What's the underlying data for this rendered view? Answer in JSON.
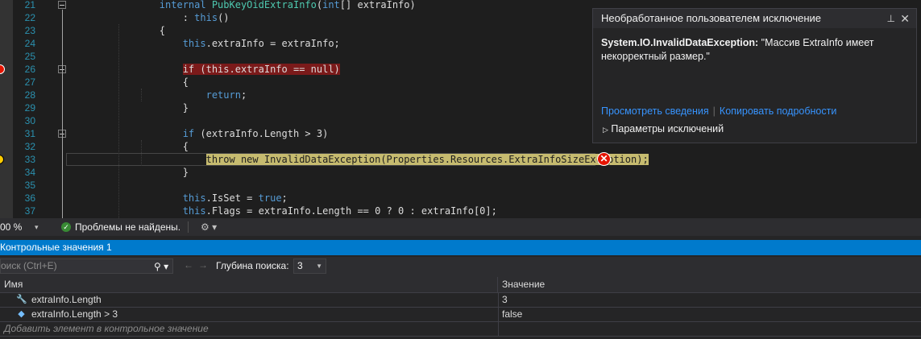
{
  "editor": {
    "lines": [
      {
        "num": "21",
        "segments": [
          {
            "t": "        "
          },
          {
            "t": "internal",
            "c": "kw"
          },
          {
            "t": " "
          },
          {
            "t": "PubKeyOidExtraInfo",
            "c": "ty"
          },
          {
            "t": "("
          },
          {
            "t": "int",
            "c": "kw"
          },
          {
            "t": "[] extraInfo)"
          }
        ]
      },
      {
        "num": "22",
        "segments": [
          {
            "t": "            : "
          },
          {
            "t": "this",
            "c": "kw"
          },
          {
            "t": "()"
          }
        ]
      },
      {
        "num": "23",
        "segments": [
          {
            "t": "        {"
          }
        ]
      },
      {
        "num": "24",
        "segments": [
          {
            "t": "            "
          },
          {
            "t": "this",
            "c": "kw"
          },
          {
            "t": ".extraInfo = extraInfo;"
          }
        ]
      },
      {
        "num": "25",
        "segments": [
          {
            "t": ""
          }
        ]
      },
      {
        "num": "26",
        "segments": [
          {
            "t": "            "
          },
          {
            "t": "if (this.extraInfo == null)",
            "c": "hl-red"
          }
        ]
      },
      {
        "num": "27",
        "segments": [
          {
            "t": "            {"
          }
        ]
      },
      {
        "num": "28",
        "segments": [
          {
            "t": "                "
          },
          {
            "t": "return",
            "c": "kw"
          },
          {
            "t": ";"
          }
        ]
      },
      {
        "num": "29",
        "segments": [
          {
            "t": "            }"
          }
        ]
      },
      {
        "num": "30",
        "segments": [
          {
            "t": ""
          }
        ]
      },
      {
        "num": "31",
        "segments": [
          {
            "t": "            "
          },
          {
            "t": "if",
            "c": "kw"
          },
          {
            "t": " (extraInfo.Length > 3)"
          }
        ]
      },
      {
        "num": "32",
        "segments": [
          {
            "t": "            {"
          }
        ]
      },
      {
        "num": "33",
        "segments": [
          {
            "t": "                "
          },
          {
            "t": "throw new InvalidDataException(Properties.Resources.ExtraInfoSizeException);",
            "c": "hl-yel"
          }
        ]
      },
      {
        "num": "34",
        "segments": [
          {
            "t": "            }"
          }
        ]
      },
      {
        "num": "35",
        "segments": [
          {
            "t": ""
          }
        ]
      },
      {
        "num": "36",
        "segments": [
          {
            "t": "            "
          },
          {
            "t": "this",
            "c": "kw"
          },
          {
            "t": ".IsSet = "
          },
          {
            "t": "true",
            "c": "kw"
          },
          {
            "t": ";"
          }
        ]
      },
      {
        "num": "37",
        "segments": [
          {
            "t": "            "
          },
          {
            "t": "this",
            "c": "kw"
          },
          {
            "t": ".Flags = extraInfo.Length == 0 ? 0 : extraInfo[0];"
          }
        ]
      }
    ],
    "error_glyph": "✕"
  },
  "exception": {
    "header": "Необработанное пользователем исключение",
    "pin_glyph": "⊥",
    "close_glyph": "✕",
    "exception_type": "System.IO.InvalidDataException:",
    "message": " \"Массив ExtraInfo имеет некорректный размер.\"",
    "link_details": "Просмотреть сведения",
    "link_copy": "Копировать подробности",
    "settings_label": "Параметры исключений",
    "settings_glyph": "▷"
  },
  "status": {
    "zoom": "00 %",
    "zoom_glyph": "▾",
    "ok_glyph": "✓",
    "problems_text": "Проблемы не найдены.",
    "brush_glyph": "⚙ ▾"
  },
  "watch": {
    "title": "Контрольные значения 1",
    "search_placeholder": "оиск (Ctrl+E)",
    "search_glyph": "⚲ ▾",
    "back_glyph": "←",
    "forward_glyph": "→",
    "depth_label": "Глубина поиска:",
    "depth_value": "3",
    "depth_chevron": "▼",
    "col_name": "Имя",
    "col_value": "Значение",
    "rows": [
      {
        "name": "extraInfo.Length",
        "value": "3",
        "icon": "wrench-icon",
        "glyph": "🔧",
        "color": "#c0c0c0"
      },
      {
        "name": "extraInfo.Length > 3",
        "value": "false",
        "icon": "cube-icon",
        "glyph": "◆",
        "color": "#75beff"
      }
    ],
    "add_row": "Добавить элемент в контрольное значение"
  },
  "colors": {
    "accent": "#007acc",
    "breakpoint": "#e51400",
    "link": "#3794ff",
    "current_statement": "#c6bb6f"
  }
}
